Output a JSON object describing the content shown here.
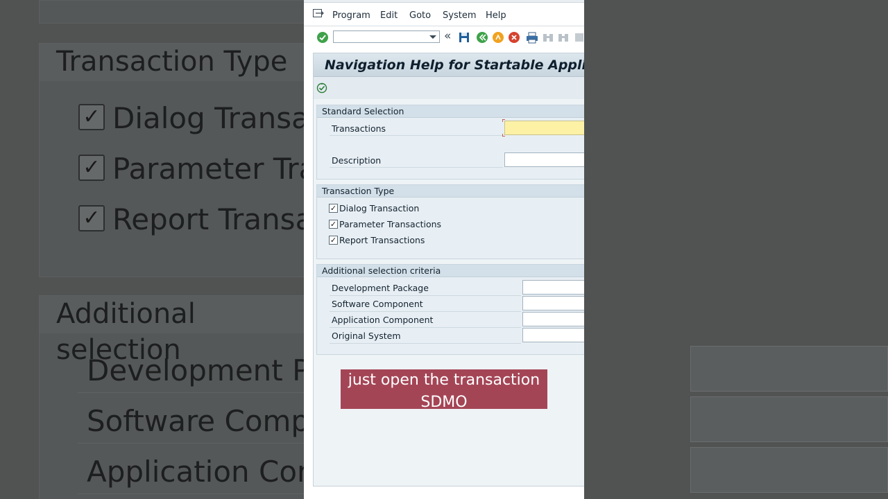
{
  "background": {
    "group_transaction_type": "Transaction Type",
    "cb1": "Dialog Transact",
    "cb2": "Parameter Tran",
    "cb3": "Report Transact",
    "group_additional": "Additional selection",
    "row1": "Development Pacl",
    "row2": "Software Compon",
    "row3": "Application Compo"
  },
  "menubar": {
    "items": [
      "Program",
      "Edit",
      "Goto",
      "System",
      "Help"
    ]
  },
  "toolbar": {
    "command_value": "",
    "icons": [
      "enter-icon",
      "save-icon",
      "back-icon",
      "exit-icon",
      "cancel-icon",
      "print-icon",
      "find-icon",
      "find-next-icon"
    ]
  },
  "screen": {
    "title": "Navigation Help for Startable Applicati",
    "standard_selection": {
      "header": "Standard Selection",
      "transactions_label": "Transactions",
      "transactions_value": "",
      "description_label": "Description",
      "description_value": ""
    },
    "transaction_type": {
      "header": "Transaction Type",
      "options": [
        {
          "label": "Dialog Transaction",
          "checked": true
        },
        {
          "label": "Parameter Transactions",
          "checked": true
        },
        {
          "label": "Report Transactions",
          "checked": true
        }
      ]
    },
    "additional": {
      "header": "Additional selection criteria",
      "fields": [
        {
          "label": "Development Package",
          "value": ""
        },
        {
          "label": "Software Component",
          "value": ""
        },
        {
          "label": "Application Component",
          "value": ""
        },
        {
          "label": "Original System",
          "value": ""
        }
      ]
    }
  },
  "caption": {
    "line1": "just open the transaction",
    "line2": "SDMO"
  },
  "colors": {
    "caption_bg": "#a44556",
    "required_field": "#fdf1a6",
    "title_bar": "#c9d6df"
  }
}
